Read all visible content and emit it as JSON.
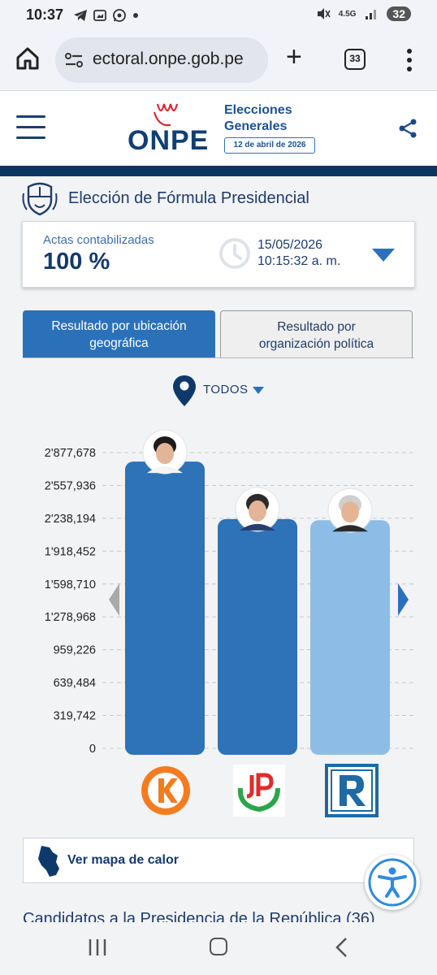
{
  "status_bar": {
    "time": "10:37",
    "left_icons": [
      "telegram-icon",
      "gallery-icon",
      "whatsapp-icon",
      "dot-icon"
    ],
    "network": "4.5G",
    "battery": "32"
  },
  "browser": {
    "url": "ectoral.onpe.gob.pe",
    "tab_count": "33"
  },
  "header": {
    "logo": "ONPE",
    "election_line1": "Elecciones",
    "election_line2": "Generales",
    "election_date": "12 de abril de 2026"
  },
  "election": {
    "title": "Elección de Fórmula Presidencial"
  },
  "actas": {
    "label": "Actas contabilizadas",
    "value": "100 %",
    "date": "15/05/2026",
    "time": "10:15:32 a. m."
  },
  "tabs": [
    {
      "line1": "Resultado por ubicación",
      "line2": "geográfica",
      "active": true
    },
    {
      "line1": "Resultado por",
      "line2": "organización política",
      "active": false
    }
  ],
  "location": {
    "label": "TODOS"
  },
  "chart_data": {
    "type": "bar",
    "categories": [
      "Fuerza Popular",
      "Juntos por el Perú",
      "Renovación Popular"
    ],
    "values": [
      2790000,
      2230000,
      2220000
    ],
    "ytick_labels": [
      "2'877,678",
      "2'557,936",
      "2'238,194",
      "1'918,452",
      "1'598,710",
      "1'278,968",
      "959,226",
      "639,484",
      "319,742",
      "0"
    ],
    "ytick_values": [
      2877678,
      2557936,
      2238194,
      1918452,
      1598710,
      1278968,
      959226,
      639484,
      319742,
      0
    ],
    "ylim": [
      0,
      2877678
    ],
    "bar_colors": [
      "#2e72b8",
      "#2e72b8",
      "#8dbde6"
    ],
    "grid": true
  },
  "heat_map": {
    "label": "Ver mapa de calor"
  },
  "candidates_heading": "Candidatos a la Presidencia de la República (36)",
  "colors": {
    "primary": "#2b71b9",
    "dark_navy": "#0c3561",
    "title_blue": "#1f3c6b",
    "light_bar": "#8dbde6"
  }
}
